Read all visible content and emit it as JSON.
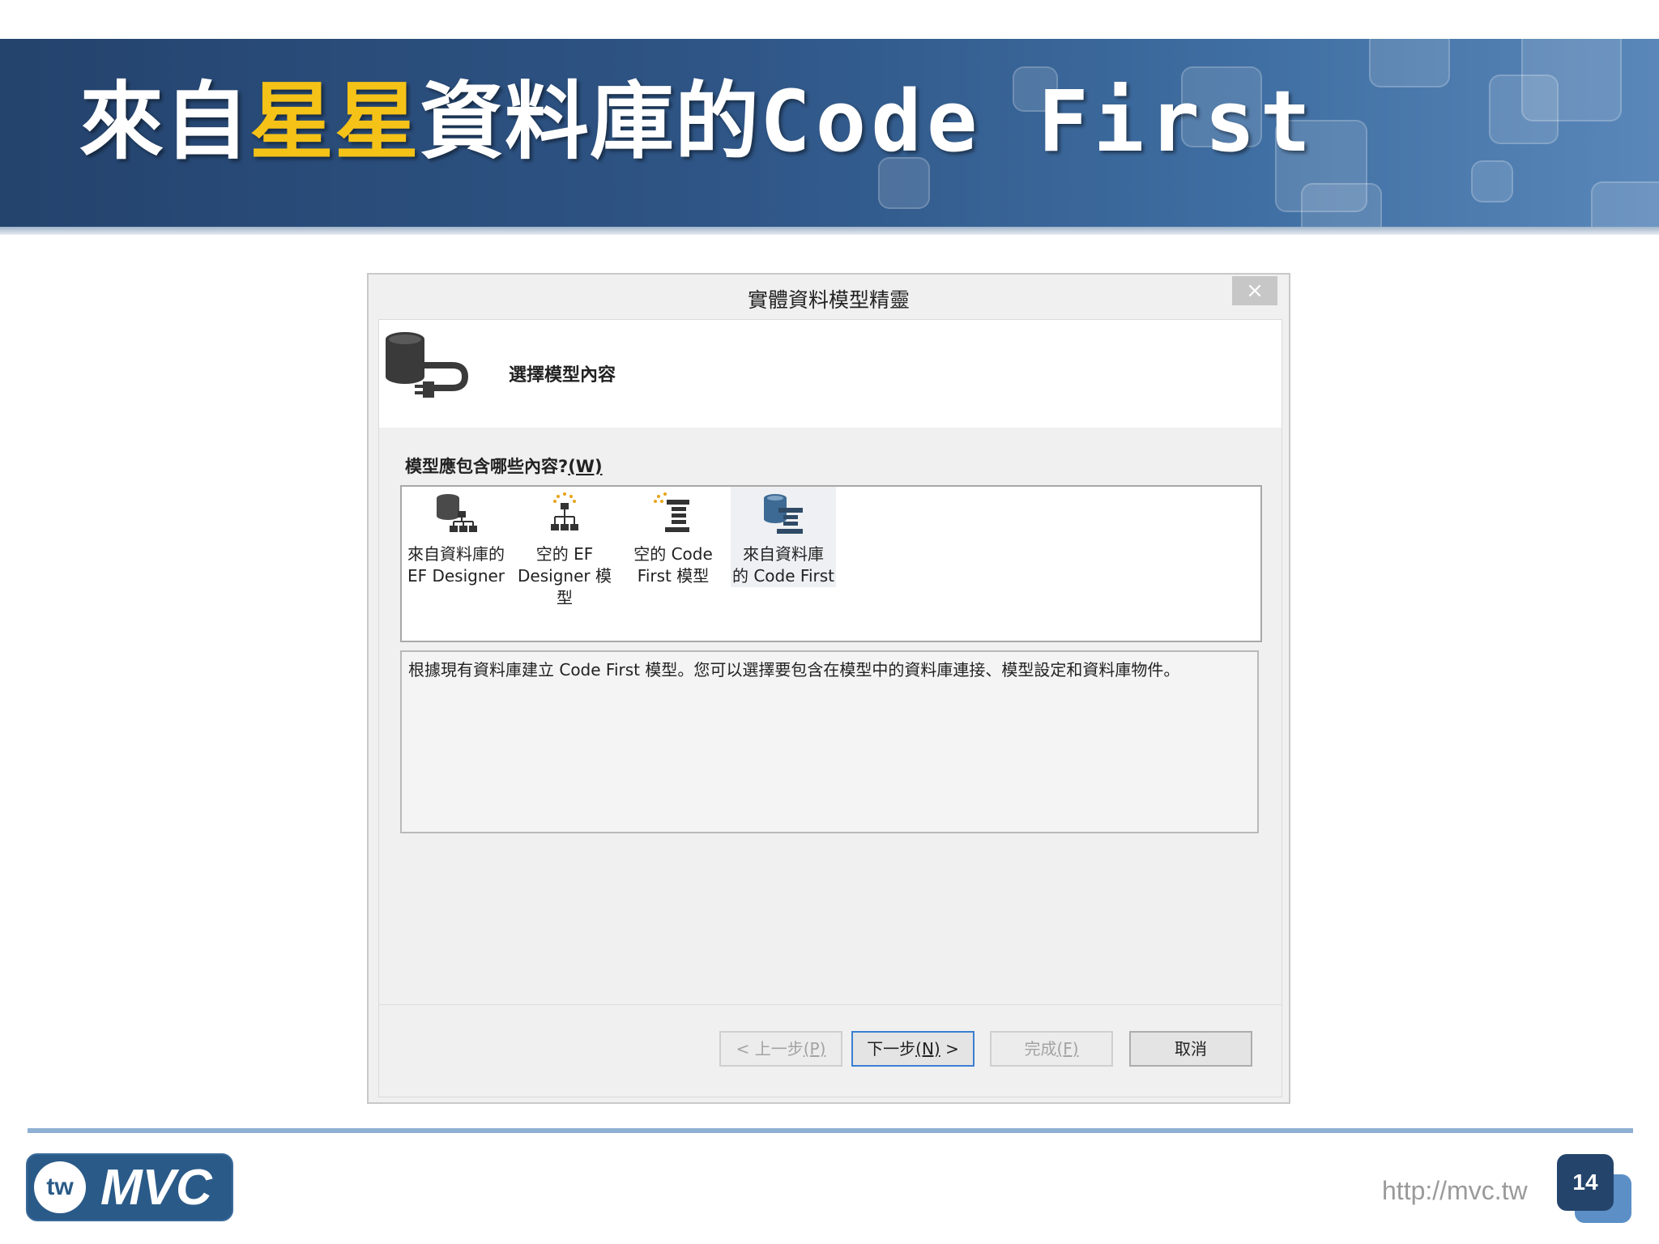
{
  "slide": {
    "title_pre": "來自",
    "title_highlight": "星星",
    "title_post": "資料庫的",
    "title_code": "Code First",
    "highlight_color": "#f5c218",
    "banner_color": "#2f5687"
  },
  "dialog": {
    "title": "實體資料模型精靈",
    "close_icon": "×",
    "header_label": "選擇模型內容",
    "prompt_text": "模型應包含哪些內容?",
    "prompt_key": "(W)",
    "choices": [
      {
        "label": "來自資料庫的\nEF Designer",
        "icon": "database-designer-icon",
        "selected": false
      },
      {
        "label": "空的 EF\nDesigner 模\n型",
        "icon": "empty-designer-icon",
        "selected": false
      },
      {
        "label": "空的 Code\nFirst 模型",
        "icon": "empty-code-first-icon",
        "selected": false
      },
      {
        "label": "來自資料庫\n的 Code First",
        "icon": "database-code-first-icon",
        "selected": true
      }
    ],
    "description": "根據現有資料庫建立 Code First 模型。您可以選擇要包含在模型中的資料庫連接、模型設定和資料庫物件。",
    "buttons": {
      "prev_pre": "< 上一步",
      "prev_key": "(P)",
      "next_pre": "下一步",
      "next_key": "(N)",
      "next_post": " >",
      "finish_pre": "完成",
      "finish_key": "(F)",
      "cancel": "取消"
    }
  },
  "footer": {
    "logo_mark": "tw",
    "logo_text": "MVC",
    "url": "http://mvc.tw",
    "page_number": "14"
  }
}
